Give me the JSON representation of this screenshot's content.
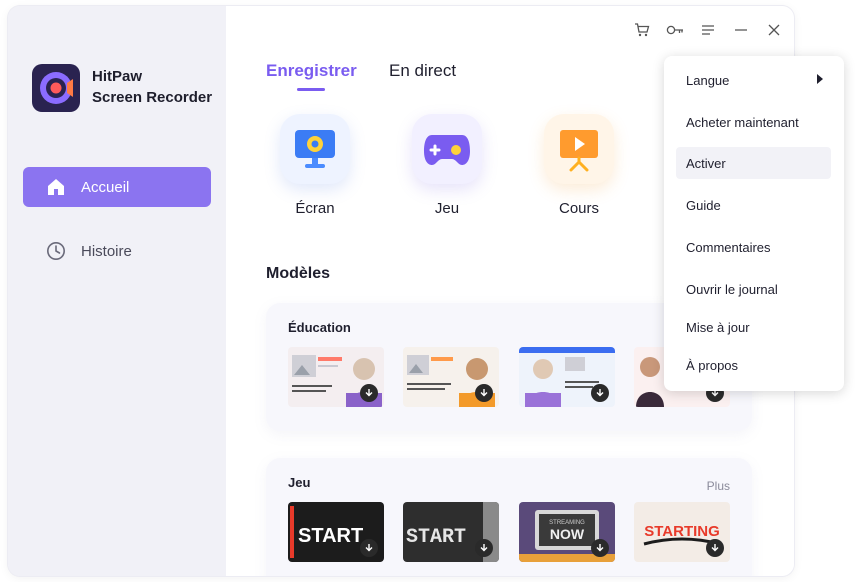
{
  "app": {
    "name_line1": "HitPaw",
    "name_line2": "Screen Recorder"
  },
  "sidebar": {
    "items": [
      {
        "label": "Accueil",
        "icon": "home-icon",
        "active": true
      },
      {
        "label": "Histoire",
        "icon": "clock-icon",
        "active": false
      }
    ]
  },
  "topbar": {
    "icons": [
      "cart-icon",
      "key-icon",
      "menu-icon",
      "minimize-icon",
      "close-icon"
    ]
  },
  "tabs": [
    {
      "label": "Enregistrer",
      "active": true
    },
    {
      "label": "En direct",
      "active": false
    }
  ],
  "modes": [
    {
      "label": "Écran",
      "icon": "monitor-camera-icon"
    },
    {
      "label": "Jeu",
      "icon": "gamepad-icon"
    },
    {
      "label": "Cours",
      "icon": "presentation-icon"
    }
  ],
  "templates": {
    "title": "Modèles",
    "education": {
      "title": "Éducation"
    },
    "game": {
      "title": "Jeu",
      "more": "Plus",
      "thumbs": [
        "START",
        "START",
        "NOW",
        "STARTING"
      ],
      "thumb_sub": "STREAMING"
    }
  },
  "menu": {
    "items": [
      {
        "label": "Langue",
        "submenu": true
      },
      {
        "label": "Acheter maintenant"
      },
      {
        "label": "Activer",
        "hover": true
      },
      {
        "label": "Guide"
      },
      {
        "label": "Commentaires"
      },
      {
        "label": "Ouvrir le journal"
      },
      {
        "label": "Mise à jour"
      },
      {
        "label": "À propos"
      }
    ]
  },
  "colors": {
    "accent": "#8b74f0",
    "tab_active": "#7a5cf0",
    "logo_bg": "#2a2350"
  }
}
